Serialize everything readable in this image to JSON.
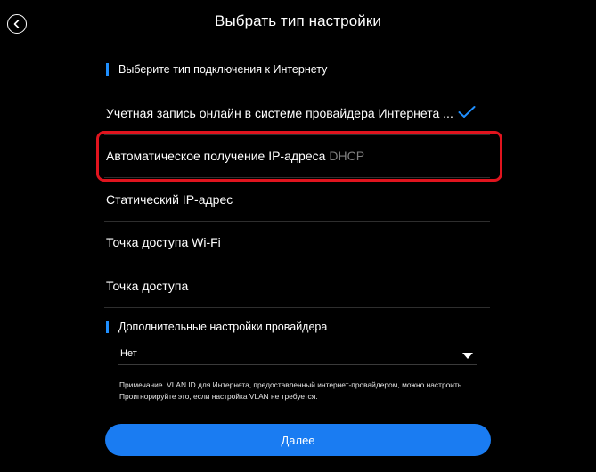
{
  "header": {
    "title": "Выбрать тип настройки",
    "back_icon": "arrow-left-circle-icon"
  },
  "connection_section": {
    "heading": "Выберите тип подключения к Интернету",
    "options": [
      {
        "label": "Учетная запись онлайн в системе провайдера Интернета ...",
        "suffix": "",
        "selected": true
      },
      {
        "label": "Автоматическое получение IP-адреса",
        "suffix": "DHCP",
        "selected": false,
        "highlighted": true
      },
      {
        "label": "Статический IP-адрес",
        "suffix": "",
        "selected": false
      },
      {
        "label": "Точка доступа Wi-Fi",
        "suffix": "",
        "selected": false
      },
      {
        "label": "Точка доступа",
        "suffix": "",
        "selected": false
      }
    ]
  },
  "provider_section": {
    "heading": "Дополнительные настройки провайдера",
    "select_value": "Нет",
    "note": "Примечание. VLAN ID для Интернета, предоставленный интернет-провайдером, можно настроить. Проигнорируйте это, если настройка VLAN не требуется."
  },
  "footer": {
    "next_label": "Далее"
  },
  "colors": {
    "background": "#000000",
    "accent": "#1a7cf2",
    "highlight_border": "#e0141e",
    "divider": "#2e2e2e",
    "muted_text": "#808080"
  }
}
